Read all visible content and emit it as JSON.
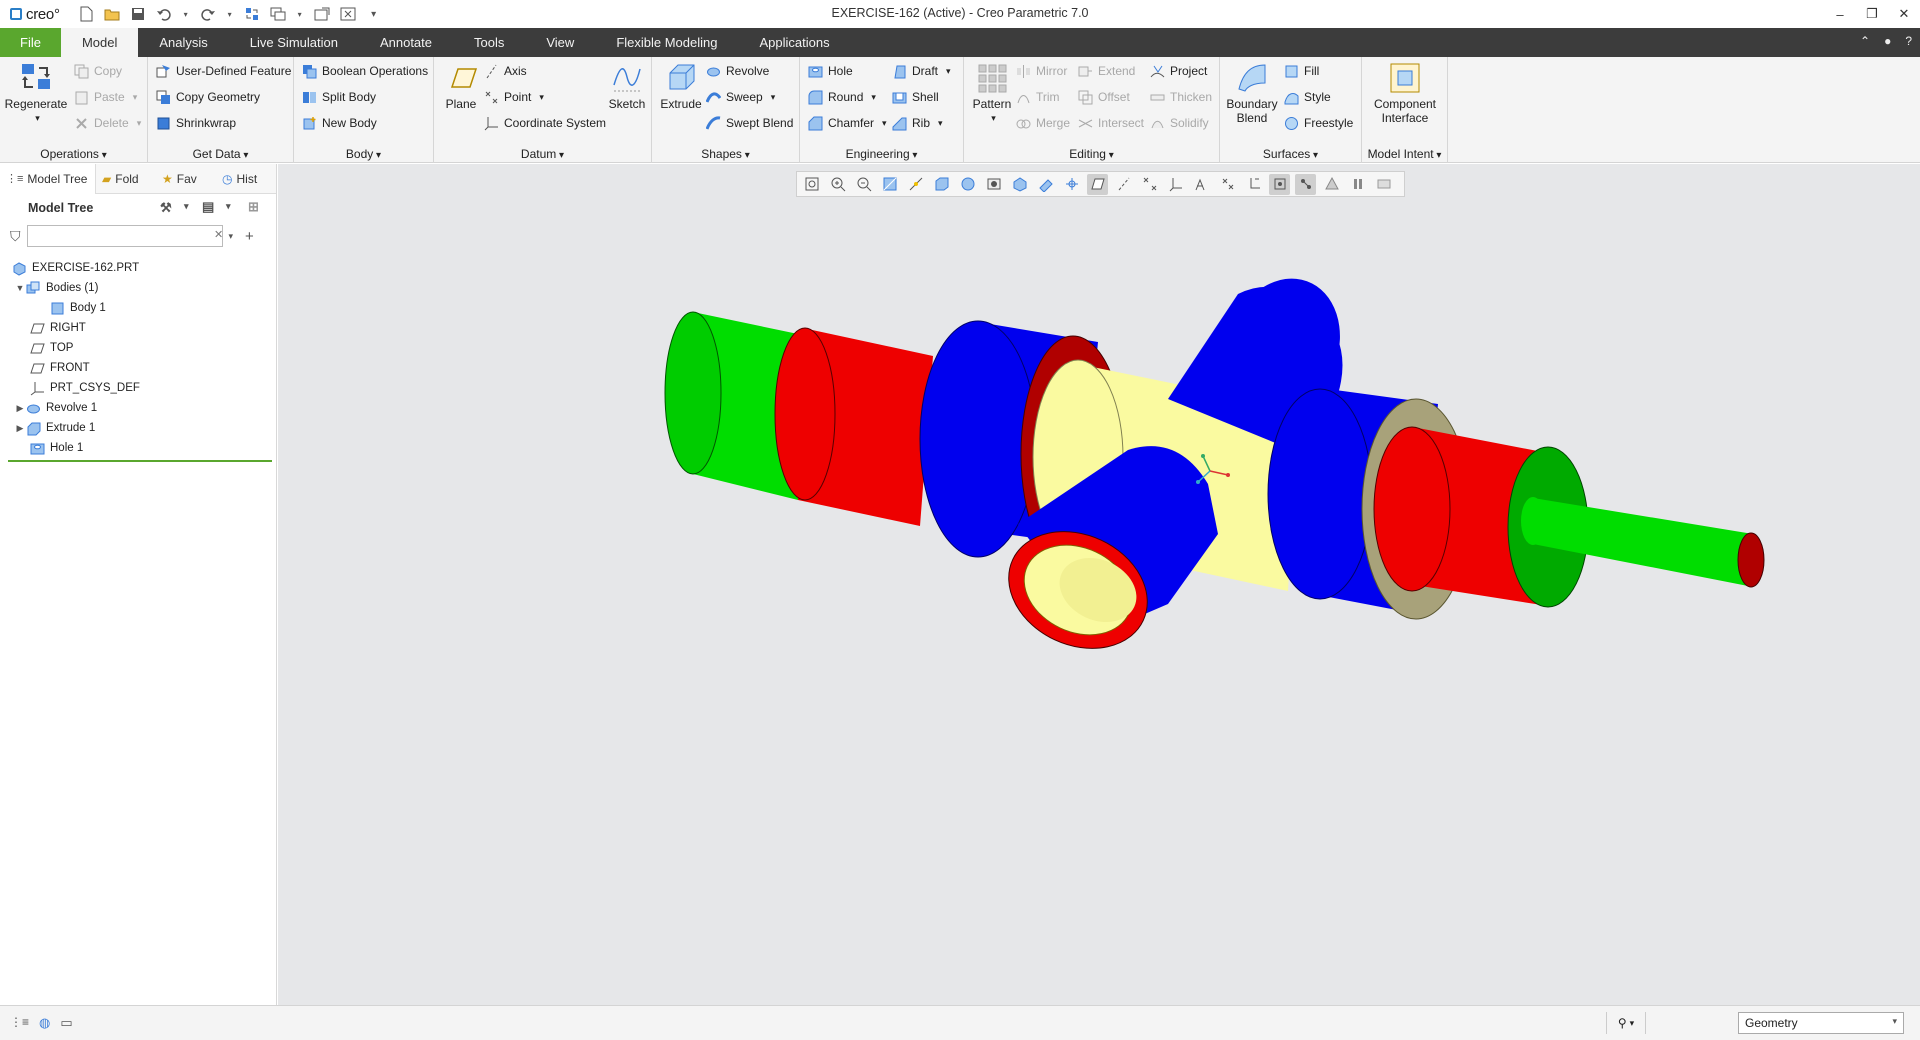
{
  "window": {
    "app_name": "creo°",
    "title": "EXERCISE-162 (Active) - Creo Parametric 7.0",
    "controls": [
      "–",
      "❐",
      "✕"
    ]
  },
  "tabs": [
    {
      "label": "File"
    },
    {
      "label": "Model"
    },
    {
      "label": "Analysis"
    },
    {
      "label": "Live Simulation"
    },
    {
      "label": "Annotate"
    },
    {
      "label": "Tools"
    },
    {
      "label": "View"
    },
    {
      "label": "Flexible Modeling"
    },
    {
      "label": "Applications"
    }
  ],
  "ribbon": {
    "operations": {
      "label": "Operations",
      "regenerate": "Regenerate",
      "copy": "Copy",
      "paste": "Paste",
      "delete": "Delete"
    },
    "get_data": {
      "label": "Get Data",
      "udf": "User-Defined Feature",
      "copy_geometry": "Copy Geometry",
      "shrinkwrap": "Shrinkwrap"
    },
    "body": {
      "label": "Body",
      "boolean": "Boolean Operations",
      "split": "Split Body",
      "new": "New Body"
    },
    "datum": {
      "label": "Datum",
      "plane": "Plane",
      "axis": "Axis",
      "point": "Point",
      "csys": "Coordinate System",
      "sketch": "Sketch"
    },
    "shapes": {
      "label": "Shapes",
      "extrude": "Extrude",
      "revolve": "Revolve",
      "sweep": "Sweep",
      "swept_blend": "Swept Blend"
    },
    "engineering": {
      "label": "Engineering",
      "hole": "Hole",
      "round": "Round",
      "chamfer": "Chamfer",
      "draft": "Draft",
      "shell": "Shell",
      "rib": "Rib"
    },
    "editing": {
      "label": "Editing",
      "pattern": "Pattern",
      "mirror": "Mirror",
      "trim": "Trim",
      "merge": "Merge",
      "extend": "Extend",
      "offset": "Offset",
      "intersect": "Intersect",
      "project": "Project",
      "thicken": "Thicken",
      "solidify": "Solidify"
    },
    "surfaces": {
      "label": "Surfaces",
      "boundary_blend_1": "Boundary",
      "boundary_blend_2": "Blend",
      "fill": "Fill",
      "style": "Style",
      "freestyle": "Freestyle"
    },
    "model_intent": {
      "label": "Model Intent",
      "component_interface_1": "Component",
      "component_interface_2": "Interface"
    }
  },
  "panel": {
    "tabs": [
      {
        "label": "Model Tree"
      },
      {
        "label": "Fold"
      },
      {
        "label": "Fav"
      },
      {
        "label": "Hist"
      }
    ],
    "header": "Model Tree",
    "search_value": "",
    "tree": [
      {
        "label": "EXERCISE-162.PRT",
        "icon": "part-icon",
        "expander": ""
      },
      {
        "label": "Bodies (1)",
        "icon": "bodies-icon",
        "expander": "▼"
      },
      {
        "label": "Body 1",
        "icon": "body-icon",
        "expander": ""
      },
      {
        "label": "RIGHT",
        "icon": "datum-plane-icon",
        "expander": ""
      },
      {
        "label": "TOP",
        "icon": "datum-plane-icon",
        "expander": ""
      },
      {
        "label": "FRONT",
        "icon": "datum-plane-icon",
        "expander": ""
      },
      {
        "label": "PRT_CSYS_DEF",
        "icon": "csys-icon",
        "expander": ""
      },
      {
        "label": "Revolve 1",
        "icon": "revolve-icon",
        "expander": "▶"
      },
      {
        "label": "Extrude 1",
        "icon": "extrude-icon",
        "expander": "▶"
      },
      {
        "label": "Hole 1",
        "icon": "hole-icon",
        "expander": ""
      }
    ]
  },
  "viewport": {
    "background": "#e6e7e9",
    "model_colors": {
      "green": "#00dd00",
      "red": "#ee0000",
      "blue": "#0000ee",
      "yellow": "#fafaa0",
      "khaki": "#a8a27a",
      "dark_red": "#b00000"
    }
  },
  "statusbar": {
    "filter_value": "Geometry"
  }
}
